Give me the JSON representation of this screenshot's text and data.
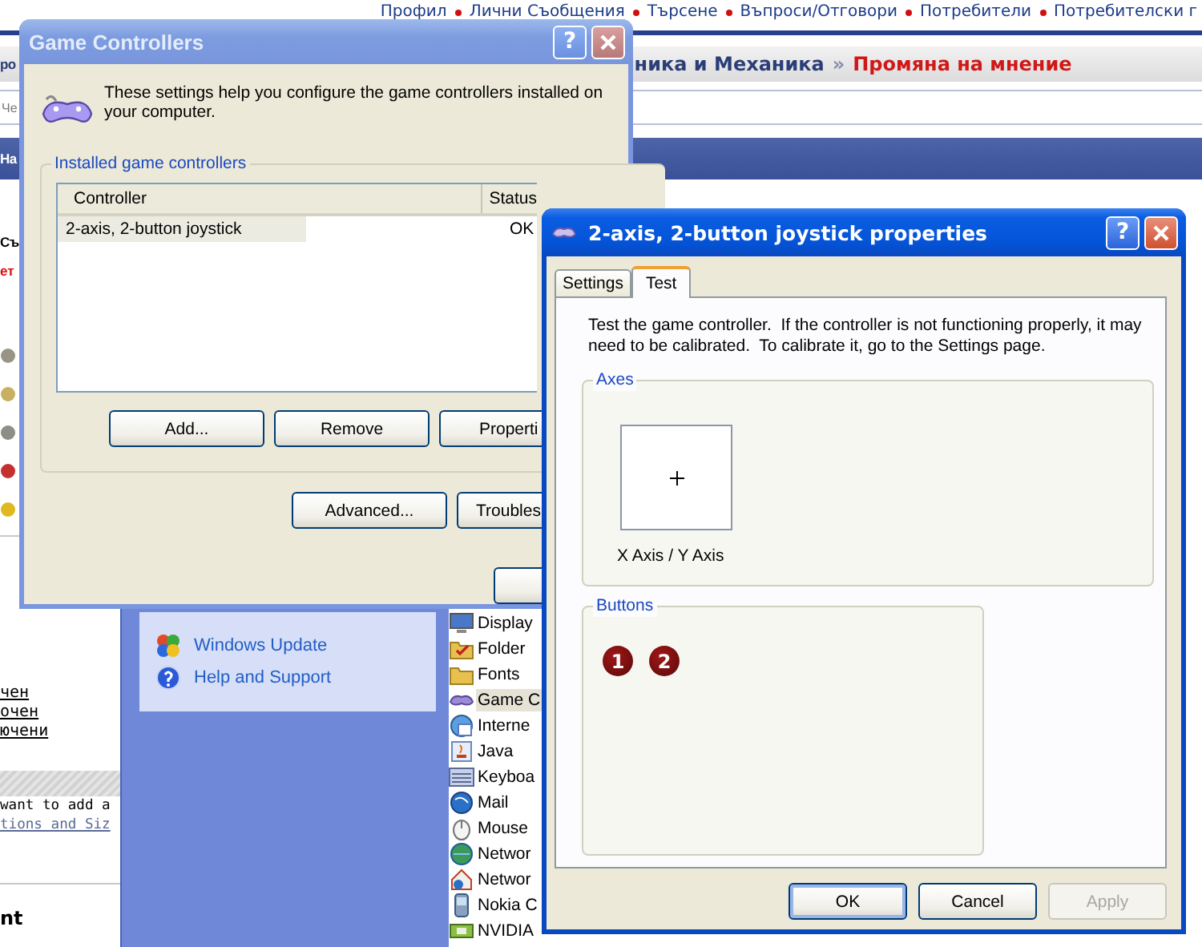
{
  "web_page": {
    "nav_links": [
      "Профил",
      "Лични Съобщения",
      "Търсене",
      "Въпроси/Отговори",
      "Потребители",
      "Потребителски г"
    ],
    "breadcrumb": {
      "fragment": "ро",
      "parent": "ника и Механика",
      "separator": "»",
      "current": "Промяна на мнение"
    },
    "field_text": "Че",
    "band_text": "На",
    "side_texts": [
      {
        "text": "Съ",
        "kind": "heading"
      },
      {
        "text": "ет",
        "kind": "alert"
      }
    ],
    "links": [
      "чен",
      "очен",
      "ючени"
    ],
    "hint": "want to add a",
    "hint_link": "tions and Siz",
    "footer_heading": "nt"
  },
  "control_panel": {
    "see_also": [
      "Windows Update",
      "Help and Support"
    ],
    "items": [
      {
        "label": "Display",
        "selected": false
      },
      {
        "label": "Folder",
        "selected": false
      },
      {
        "label": "Fonts",
        "selected": false
      },
      {
        "label": "Game C",
        "selected": true
      },
      {
        "label": "Interne",
        "selected": false
      },
      {
        "label": "Java",
        "selected": false
      },
      {
        "label": "Keyboa",
        "selected": false
      },
      {
        "label": "Mail",
        "selected": false
      },
      {
        "label": "Mouse",
        "selected": false
      },
      {
        "label": "Networ",
        "selected": false
      },
      {
        "label": "Networ",
        "selected": false
      },
      {
        "label": "Nokia C",
        "selected": false
      },
      {
        "label": "NVIDIA",
        "selected": false
      }
    ]
  },
  "game_controllers": {
    "title": "Game Controllers",
    "help_button": "?",
    "intro": "These settings help you configure the game controllers installed on your computer.",
    "group_title": "Installed game controllers",
    "columns": [
      "Controller",
      "Status"
    ],
    "rows": [
      {
        "cells": [
          "2-axis, 2-button joystick",
          "OK"
        ],
        "selected": true
      }
    ],
    "buttons": [
      "Add...",
      "Remove",
      "Properti"
    ],
    "footer_buttons": [
      "Advanced...",
      "Troubles"
    ]
  },
  "properties": {
    "title": "2-axis, 2-button joystick properties",
    "help_button": "?",
    "tabs": [
      {
        "label": "Settings",
        "selected": false
      },
      {
        "label": "Test",
        "selected": true
      }
    ],
    "description": "Test the game controller.  If the controller is not functioning properly, it may need to be calibrated.  To calibrate it, go to the Settings page.",
    "axes": {
      "title": "Axes",
      "label": "X Axis / Y Axis"
    },
    "buttons_group": {
      "title": "Buttons",
      "buttons": [
        "1",
        "2"
      ]
    },
    "actions": [
      {
        "label": "OK",
        "default": true,
        "disabled": false
      },
      {
        "label": "Cancel",
        "default": false,
        "disabled": false
      },
      {
        "label": "Apply",
        "default": false,
        "disabled": true
      }
    ]
  }
}
